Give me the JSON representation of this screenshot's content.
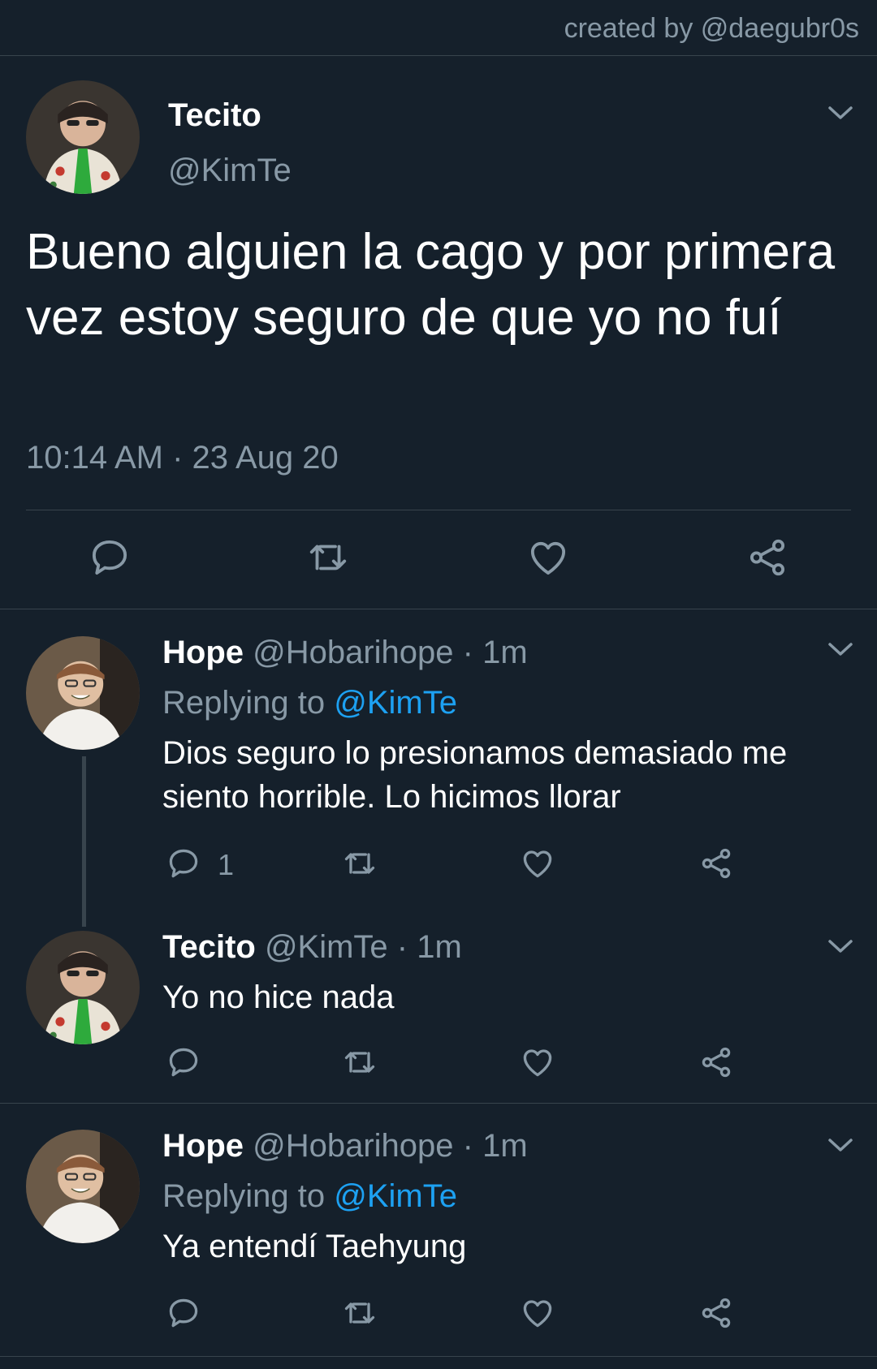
{
  "credit": "created by @daegubr0s",
  "main_tweet": {
    "name": "Tecito",
    "handle": "@KimTe",
    "text": "Bueno alguien la cago y por primera vez estoy seguro de que yo no fuí",
    "timestamp": "10:14 AM · 23 Aug 20",
    "actions": [
      "reply-icon",
      "retweet-icon",
      "like-icon",
      "share-icon"
    ]
  },
  "replies": [
    {
      "name": "Hope",
      "meta": " @Hobarihope · 1m",
      "replying_prefix": "Replying to ",
      "replying_to": "@KimTe",
      "text": "Dios seguro lo presionamos demasiado me siento horrible. Lo hicimos llorar",
      "reply_count": "1"
    },
    {
      "name": "Tecito",
      "meta": " @KimTe · 1m",
      "text": "Yo no hice nada"
    },
    {
      "name": "Hope",
      "meta": " @Hobarihope · 1m",
      "replying_prefix": "Replying to ",
      "replying_to": "@KimTe",
      "text": "Ya entendí Taehyung"
    }
  ],
  "colors": {
    "background": "#15202b",
    "text_secondary": "#8899a6",
    "accent": "#1da1f2",
    "divider": "#38444d"
  }
}
